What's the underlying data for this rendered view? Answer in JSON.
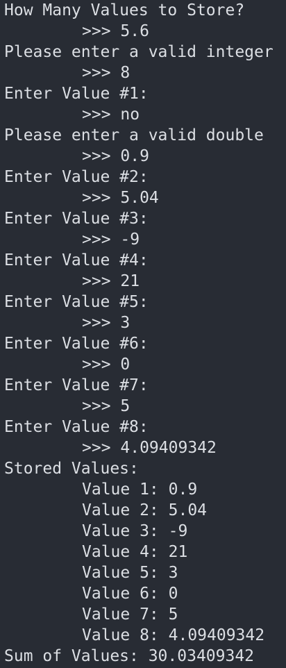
{
  "terminal": {
    "lines": [
      {
        "kind": "output",
        "text": "How Many Values to Store?"
      },
      {
        "kind": "input",
        "prompt": ">>> ",
        "value": "5.6"
      },
      {
        "kind": "output",
        "text": "Please enter a valid integer"
      },
      {
        "kind": "input",
        "prompt": ">>> ",
        "value": "8"
      },
      {
        "kind": "output",
        "text": "Enter Value #1:"
      },
      {
        "kind": "input",
        "prompt": ">>> ",
        "value": "no"
      },
      {
        "kind": "output",
        "text": "Please enter a valid double"
      },
      {
        "kind": "input",
        "prompt": ">>> ",
        "value": "0.9"
      },
      {
        "kind": "output",
        "text": "Enter Value #2:"
      },
      {
        "kind": "input",
        "prompt": ">>> ",
        "value": "5.04"
      },
      {
        "kind": "output",
        "text": "Enter Value #3:"
      },
      {
        "kind": "input",
        "prompt": ">>> ",
        "value": "-9"
      },
      {
        "kind": "output",
        "text": "Enter Value #4:"
      },
      {
        "kind": "input",
        "prompt": ">>> ",
        "value": "21"
      },
      {
        "kind": "output",
        "text": "Enter Value #5:"
      },
      {
        "kind": "input",
        "prompt": ">>> ",
        "value": "3"
      },
      {
        "kind": "output",
        "text": "Enter Value #6:"
      },
      {
        "kind": "input",
        "prompt": ">>> ",
        "value": "0"
      },
      {
        "kind": "output",
        "text": "Enter Value #7:"
      },
      {
        "kind": "input",
        "prompt": ">>> ",
        "value": "5"
      },
      {
        "kind": "output",
        "text": "Enter Value #8:"
      },
      {
        "kind": "input",
        "prompt": ">>> ",
        "value": "4.09409342"
      },
      {
        "kind": "output",
        "text": "Stored Values:"
      },
      {
        "kind": "stored",
        "text": "Value 1: 0.9"
      },
      {
        "kind": "stored",
        "text": "Value 2: 5.04"
      },
      {
        "kind": "stored",
        "text": "Value 3: -9"
      },
      {
        "kind": "stored",
        "text": "Value 4: 21"
      },
      {
        "kind": "stored",
        "text": "Value 5: 3"
      },
      {
        "kind": "stored",
        "text": "Value 6: 0"
      },
      {
        "kind": "stored",
        "text": "Value 7: 5"
      },
      {
        "kind": "stored",
        "text": "Value 8: 4.09409342"
      },
      {
        "kind": "output",
        "text": "Sum of Values: 30.03409342"
      }
    ]
  },
  "colors": {
    "background": "#282c34",
    "text": "#dcdfe4"
  }
}
